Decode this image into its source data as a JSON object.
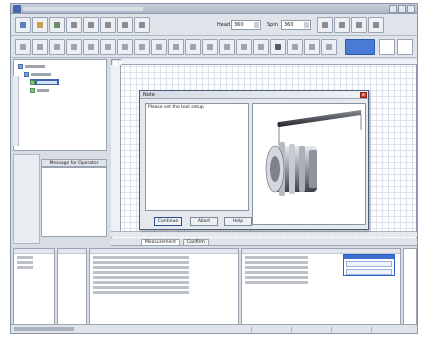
{
  "toolbar": {
    "head_label": "Head",
    "head_value": "360",
    "spin_label": "Spin",
    "spin_value": "360"
  },
  "left_panel": {
    "message_header": "Message for Operator"
  },
  "dialog": {
    "title": "Note",
    "close_glyph": "x",
    "message": "Please set the tool setup",
    "buttons": {
      "continue": "Continue",
      "abort": "Abort",
      "help": "Help"
    }
  },
  "tabs": [
    {
      "label": "Measurement"
    },
    {
      "label": "Confirm"
    }
  ],
  "colors": {
    "accent": "#4a7bd4",
    "close_red": "#d33a2c",
    "selection": "#3b64b0"
  },
  "icons": {
    "tree_folder": "folder-icon",
    "tree_program": "program-icon",
    "tool_image": "machining-tool-icon"
  }
}
